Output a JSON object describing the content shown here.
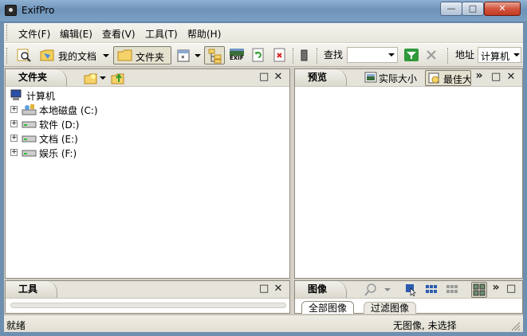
{
  "window": {
    "title": "ExifPro",
    "min_glyph": "—",
    "max_glyph": "□",
    "close_glyph": "✕"
  },
  "menu": [
    "文件(F)",
    "编辑(E)",
    "查看(V)",
    "工具(T)",
    "帮助(H)"
  ],
  "toolbar": {
    "my_docs_label": "我的文档",
    "folder_label": "文件夹",
    "exif_label": "EXIF",
    "find_label": "查找",
    "find_value": "",
    "address_label": "地址",
    "address_value": "计算机"
  },
  "panes": {
    "folders": {
      "title": "文件夹",
      "close": "✕",
      "max": "□"
    },
    "preview": {
      "title": "预览",
      "actual_size": "实际大小",
      "best_fit": "最佳大",
      "more": "»",
      "close": "✕",
      "max": "□"
    },
    "tools": {
      "title": "工具",
      "close": "✕",
      "max": "□"
    },
    "images": {
      "title": "图像",
      "more": "»",
      "max": "□",
      "tabs": [
        "全部图像",
        "过滤图像"
      ]
    }
  },
  "tree": {
    "root": "计算机",
    "items": [
      {
        "label": "本地磁盘 (C:)"
      },
      {
        "label": "软件 (D:)"
      },
      {
        "label": "文档 (E:)"
      },
      {
        "label": "娱乐 (F:)"
      }
    ]
  },
  "status": {
    "left": "就绪",
    "right": "无图像, 未选择"
  },
  "colors": {
    "accent": "#316ac5",
    "chrome": "#d4d0c8",
    "titlebar": "#7aa0c4"
  }
}
